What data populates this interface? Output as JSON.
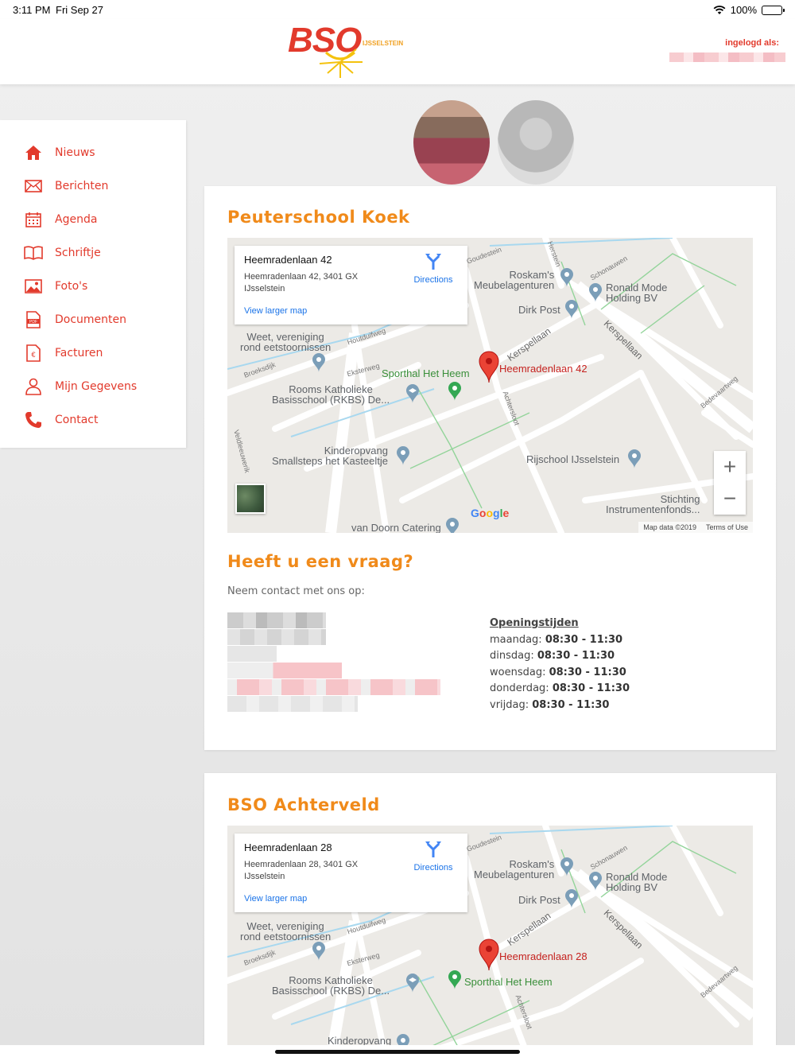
{
  "status": {
    "time": "3:11 PM",
    "date": "Fri Sep 27",
    "battery": "100%"
  },
  "header": {
    "logo_text": "BSO",
    "logo_town": "IJSSELSTEIN",
    "login_label": "ingelogd als:"
  },
  "sidebar": {
    "items": [
      {
        "label": "Nieuws",
        "icon": "home-icon"
      },
      {
        "label": "Berichten",
        "icon": "envelope-icon"
      },
      {
        "label": "Agenda",
        "icon": "calendar-icon"
      },
      {
        "label": "Schriftje",
        "icon": "book-icon"
      },
      {
        "label": "Foto's",
        "icon": "image-icon"
      },
      {
        "label": "Documenten",
        "icon": "pdf-icon"
      },
      {
        "label": "Facturen",
        "icon": "invoice-euro-icon"
      },
      {
        "label": "Mijn Gegevens",
        "icon": "user-icon"
      },
      {
        "label": "Contact",
        "icon": "phone-icon"
      }
    ]
  },
  "locations": [
    {
      "title": "Peuterschool Koek",
      "map": {
        "place_name": "Heemradenlaan 42",
        "address_line1": "Heemradenlaan 42, 3401 GX",
        "address_line2": "IJsselstein",
        "directions": "Directions",
        "view_larger": "View larger map",
        "pin_label": "Heemradenlaan 42",
        "labels": {
          "weet": "Weet, vereniging\nrond eetstoornissen",
          "sporthal": "Sporthal Het Heem",
          "rkbs": "Rooms Katholieke\nBasisschool (RKBS) De...",
          "kinderopvang": "Kinderopvang\nSmallsteps het Kasteeltje",
          "roskam": "Roskam's\nMeubelagenturen",
          "ronald": "Ronald Mode\nHolding BV",
          "dirk": "Dirk Post",
          "rijschool": "Rijschool IJsselstein",
          "stichting": "Stichting\nInstrumentenfonds...",
          "vandoorn": "van Doorn Catering",
          "kerspellaan": "Kerspellaan",
          "kerspellaan2": "Kerspellaan",
          "achtersloot": "Achtersloot",
          "houtduifweg": "Houtduifweg",
          "eksterweg": "Eksterweg",
          "broeksdijk": "Broeksdijk",
          "veldleeuwerik": "Veldleeuwerik",
          "schonauwen": "Schonauwen",
          "goudestein": "Goudestein",
          "bedevaartweg": "Bedevaartweg",
          "herstein": "Herstein"
        },
        "google": [
          "G",
          "o",
          "o",
          "g",
          "l",
          "e"
        ],
        "map_data": "Map data ©2019",
        "terms": "Terms of Use",
        "zoom_in": "+",
        "zoom_out": "−"
      }
    },
    {
      "title": "BSO Achterveld",
      "map": {
        "place_name": "Heemradenlaan 28",
        "address_line1": "Heemradenlaan 28, 3401 GX",
        "address_line2": "IJsselstein",
        "directions": "Directions",
        "view_larger": "View larger map",
        "pin_label": "Heemradenlaan 28",
        "labels": {
          "weet": "Weet, vereniging\nrond eetstoornissen",
          "sporthal": "Sporthal Het Heem",
          "rkbs": "Rooms Katholieke\nBasisschool (RKBS) De...",
          "kinderopvang": "Kinderopvang",
          "roskam": "Roskam's\nMeubelagenturen",
          "ronald": "Ronald Mode\nHolding BV",
          "dirk": "Dirk Post",
          "kerspellaan": "Kerspellaan",
          "kerspellaan2": "Kerspellaan",
          "achtersloot": "Achtersloot",
          "houtduifweg": "Houtduifweg",
          "eksterweg": "Eksterweg",
          "broeksdijk": "Broeksdijk",
          "schonauwen": "Schonauwen",
          "goudestein": "Goudestein",
          "bedevaartweg": "Bedevaartweg"
        }
      }
    }
  ],
  "contact": {
    "title": "Heeft u een vraag?",
    "subtitle": "Neem contact met ons op:",
    "hours_title": "Openingstijden",
    "hours": [
      {
        "day": "maandag:",
        "time": "08:30 - 11:30"
      },
      {
        "day": "dinsdag:",
        "time": "08:30 - 11:30"
      },
      {
        "day": "woensdag:",
        "time": "08:30 - 11:30"
      },
      {
        "day": "donderdag:",
        "time": "08:30 - 11:30"
      },
      {
        "day": "vrijdag:",
        "time": "08:30 - 11:30"
      }
    ]
  },
  "colors": {
    "brand_red": "#e23a2c",
    "accent_orange": "#f08a1a",
    "link_blue": "#1a73e8"
  }
}
